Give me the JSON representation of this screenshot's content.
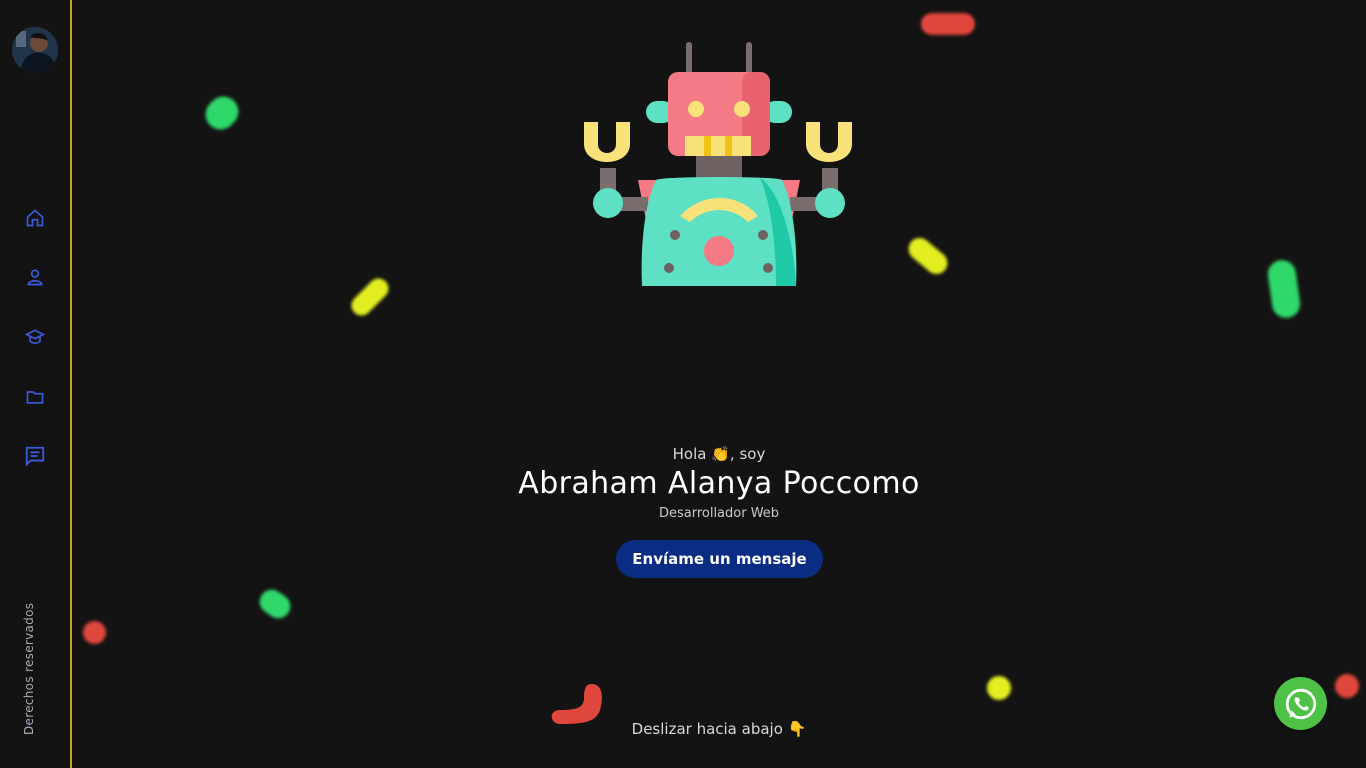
{
  "sidebar": {
    "avatar_icon": "avatar",
    "nav": [
      {
        "icon": "home-icon"
      },
      {
        "icon": "user-icon"
      },
      {
        "icon": "graduation-cap-icon"
      },
      {
        "icon": "folder-icon"
      },
      {
        "icon": "message-icon"
      }
    ],
    "rights_text": "Derechos reservados",
    "accent_color": "#c9a227",
    "icon_color": "#3b5bdb"
  },
  "hero": {
    "hello": "Hola 👏, soy",
    "name": "Abraham Alanya Poccomo",
    "role": "Desarrollador Web",
    "cta_label": "Envíame un mensaje",
    "cta_color": "#0a2c82",
    "scroll_hint": "Deslizar hacia abajo 👇"
  },
  "whatsapp": {
    "icon": "whatsapp-icon",
    "color": "#4dc247"
  }
}
